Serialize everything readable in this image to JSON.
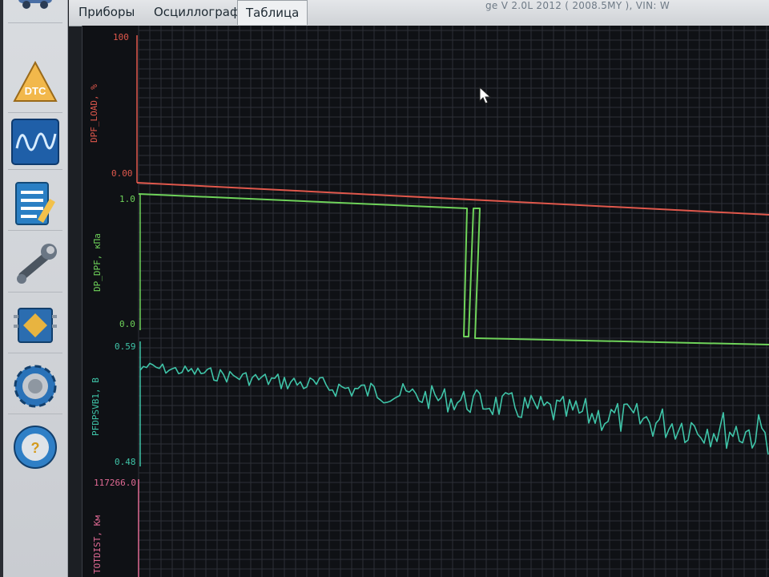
{
  "tabs": [
    {
      "label": "Приборы"
    },
    {
      "label": "Осциллограф"
    },
    {
      "label": "Таблица"
    }
  ],
  "title_bar": "ge V 2.0L 2012 ( 2008.5MY ), VIN: W",
  "toolbar": {
    "items": [
      {
        "icon": "car-icon"
      },
      {
        "icon": "dtc-warning-icon",
        "label": "DTC"
      },
      {
        "icon": "oscilloscope-icon"
      },
      {
        "icon": "checklist-icon"
      },
      {
        "icon": "wrench-icon"
      },
      {
        "icon": "chip-icon"
      },
      {
        "icon": "gear-icon"
      },
      {
        "icon": "steering-wheel-icon"
      }
    ]
  },
  "channels": [
    {
      "name": "DPF_LOAD, %",
      "max": "100",
      "min": "0.00",
      "color": "#e0584c"
    },
    {
      "name": "DP_DPF, кПа",
      "max": "1.0",
      "min": "0.0",
      "color": "#6fd35a"
    },
    {
      "name": "PFDPSVB1, В",
      "max": "0.59",
      "min": "0.48",
      "color": "#3fc4a8"
    },
    {
      "name": "TOTDIST, Км",
      "max": "117266.0",
      "min": "",
      "color": "#e06a94"
    }
  ]
}
